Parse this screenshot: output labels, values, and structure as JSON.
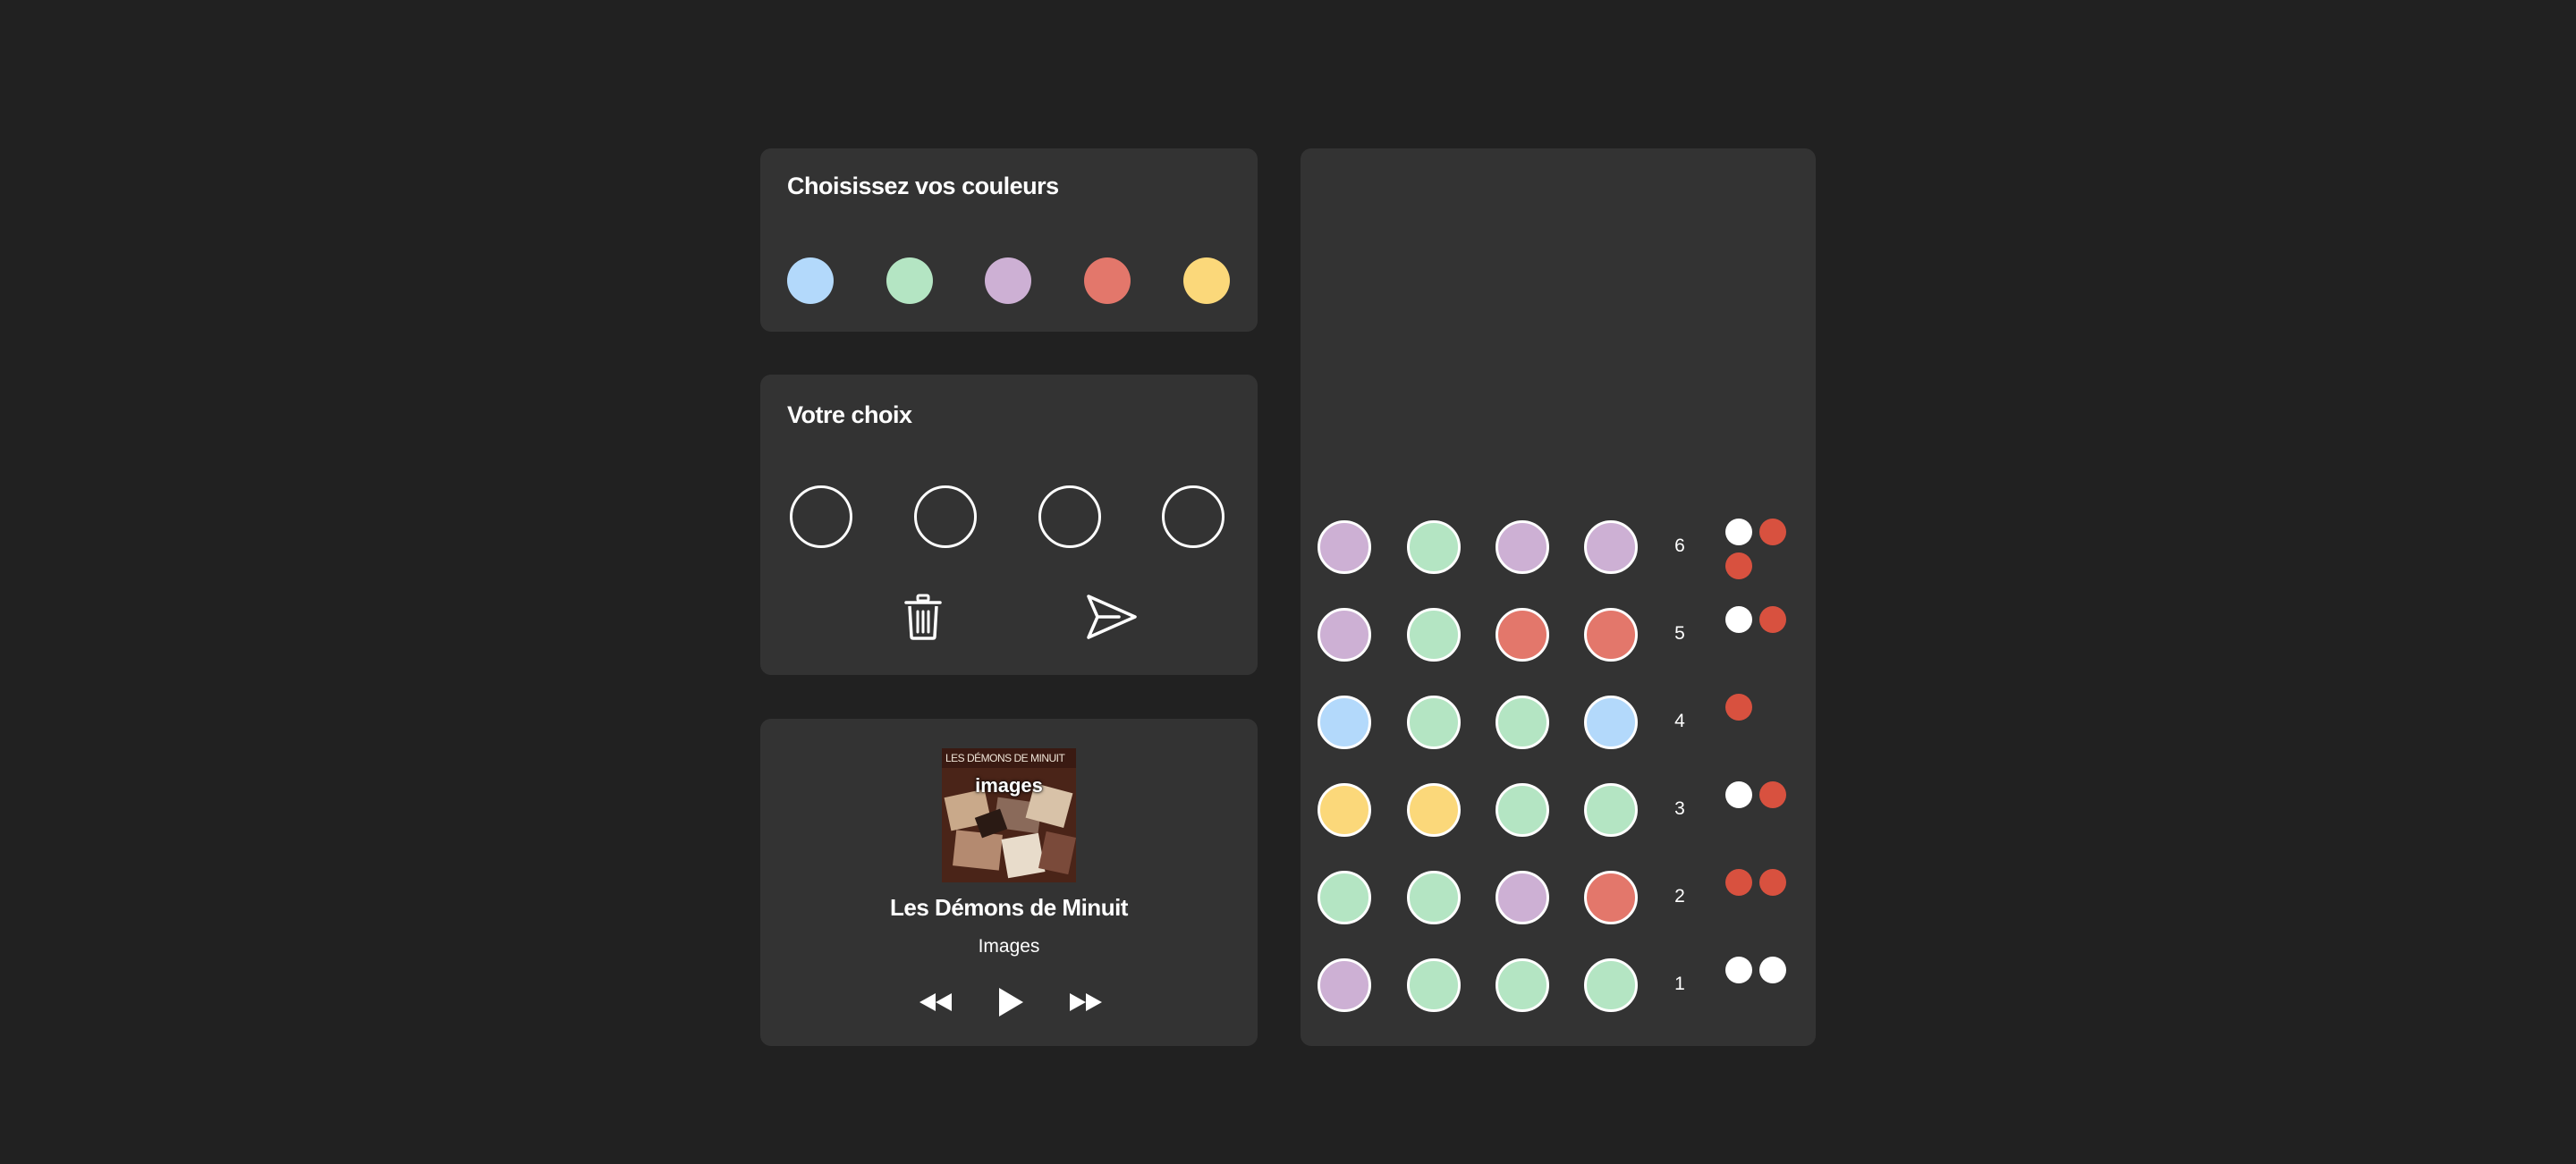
{
  "colors": {
    "blue": "#b3d9fb",
    "green": "#b4e5c3",
    "purple": "#cdb0d4",
    "red": "#e3776b",
    "yellow": "#fbd87a",
    "key_white": "#ffffff",
    "key_red": "#d8513f"
  },
  "picker": {
    "title": "Choisissez vos couleurs",
    "palette": [
      "blue",
      "green",
      "purple",
      "red",
      "yellow"
    ]
  },
  "choice": {
    "title": "Votre choix",
    "slots": [
      null,
      null,
      null,
      null
    ],
    "delete_icon": "trash-icon",
    "submit_icon": "send-icon"
  },
  "player": {
    "cover_top_text": "LES DÉMONS DE MINUIT",
    "cover_logo_text": "images",
    "title": "Les Démons de Minuit",
    "album": "Images",
    "controls": [
      "rewind-icon",
      "play-icon",
      "fast-forward-icon"
    ]
  },
  "board": {
    "rows": [
      {
        "number": "6",
        "pegs": [
          "purple",
          "green",
          "purple",
          "purple"
        ],
        "keys": [
          "white",
          "red",
          "red"
        ]
      },
      {
        "number": "5",
        "pegs": [
          "purple",
          "green",
          "red",
          "red"
        ],
        "keys": [
          "white",
          "red"
        ]
      },
      {
        "number": "4",
        "pegs": [
          "blue",
          "green",
          "green",
          "blue"
        ],
        "keys": [
          "red"
        ]
      },
      {
        "number": "3",
        "pegs": [
          "yellow",
          "yellow",
          "green",
          "green"
        ],
        "keys": [
          "white",
          "red"
        ]
      },
      {
        "number": "2",
        "pegs": [
          "green",
          "green",
          "purple",
          "red"
        ],
        "keys": [
          "red",
          "red"
        ]
      },
      {
        "number": "1",
        "pegs": [
          "purple",
          "green",
          "green",
          "green"
        ],
        "keys": [
          "white",
          "white"
        ]
      }
    ]
  }
}
